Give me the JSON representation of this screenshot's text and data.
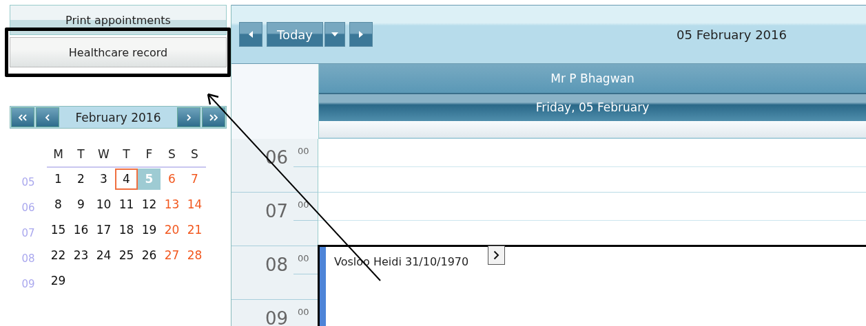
{
  "sidebar": {
    "buttons": [
      {
        "label": "Print appointments",
        "kind": "plain"
      },
      {
        "label": "Healthcare record",
        "kind": "highlighted"
      }
    ]
  },
  "mini_calendar": {
    "title": "February 2016",
    "weekdays": [
      "M",
      "T",
      "W",
      "T",
      "F",
      "S",
      "S"
    ],
    "weeks": [
      {
        "number": "05",
        "days": [
          {
            "day": "1",
            "kind": "weekday",
            "selected": false,
            "today": false
          },
          {
            "day": "2",
            "kind": "weekday",
            "selected": false,
            "today": false
          },
          {
            "day": "3",
            "kind": "weekday",
            "selected": false,
            "today": false
          },
          {
            "day": "4",
            "kind": "weekday",
            "selected": false,
            "today": true
          },
          {
            "day": "5",
            "kind": "weekday",
            "selected": true,
            "today": false
          },
          {
            "day": "6",
            "kind": "weekend",
            "selected": false,
            "today": false
          },
          {
            "day": "7",
            "kind": "weekend",
            "selected": false,
            "today": false
          }
        ]
      },
      {
        "number": "06",
        "days": [
          {
            "day": "8",
            "kind": "weekday",
            "selected": false,
            "today": false
          },
          {
            "day": "9",
            "kind": "weekday",
            "selected": false,
            "today": false
          },
          {
            "day": "10",
            "kind": "weekday",
            "selected": false,
            "today": false
          },
          {
            "day": "11",
            "kind": "weekday",
            "selected": false,
            "today": false
          },
          {
            "day": "12",
            "kind": "weekday",
            "selected": false,
            "today": false
          },
          {
            "day": "13",
            "kind": "weekend",
            "selected": false,
            "today": false
          },
          {
            "day": "14",
            "kind": "weekend",
            "selected": false,
            "today": false
          }
        ]
      },
      {
        "number": "07",
        "days": [
          {
            "day": "15",
            "kind": "weekday",
            "selected": false,
            "today": false
          },
          {
            "day": "16",
            "kind": "weekday",
            "selected": false,
            "today": false
          },
          {
            "day": "17",
            "kind": "weekday",
            "selected": false,
            "today": false
          },
          {
            "day": "18",
            "kind": "weekday",
            "selected": false,
            "today": false
          },
          {
            "day": "19",
            "kind": "weekday",
            "selected": false,
            "today": false
          },
          {
            "day": "20",
            "kind": "weekend",
            "selected": false,
            "today": false
          },
          {
            "day": "21",
            "kind": "weekend",
            "selected": false,
            "today": false
          }
        ]
      },
      {
        "number": "08",
        "days": [
          {
            "day": "22",
            "kind": "weekday",
            "selected": false,
            "today": false
          },
          {
            "day": "23",
            "kind": "weekday",
            "selected": false,
            "today": false
          },
          {
            "day": "24",
            "kind": "weekday",
            "selected": false,
            "today": false
          },
          {
            "day": "25",
            "kind": "weekday",
            "selected": false,
            "today": false
          },
          {
            "day": "26",
            "kind": "weekday",
            "selected": false,
            "today": false
          },
          {
            "day": "27",
            "kind": "weekend",
            "selected": false,
            "today": false
          },
          {
            "day": "28",
            "kind": "weekend",
            "selected": false,
            "today": false
          }
        ]
      },
      {
        "number": "09",
        "days": [
          {
            "day": "29",
            "kind": "weekday",
            "selected": false,
            "today": false
          }
        ]
      }
    ]
  },
  "toolbar": {
    "today_label": "Today",
    "date": "05 February 2016"
  },
  "schedule": {
    "resource": "Mr P Bhagwan",
    "day": "Friday, 05 February",
    "hours": [
      {
        "hour": "06",
        "minutes": "00"
      },
      {
        "hour": "07",
        "minutes": "00"
      },
      {
        "hour": "08",
        "minutes": "00",
        "appointments": [
          {
            "text": "Vosloo Heidi 31/10/1970"
          }
        ]
      },
      {
        "hour": "09",
        "minutes": "00"
      }
    ]
  }
}
